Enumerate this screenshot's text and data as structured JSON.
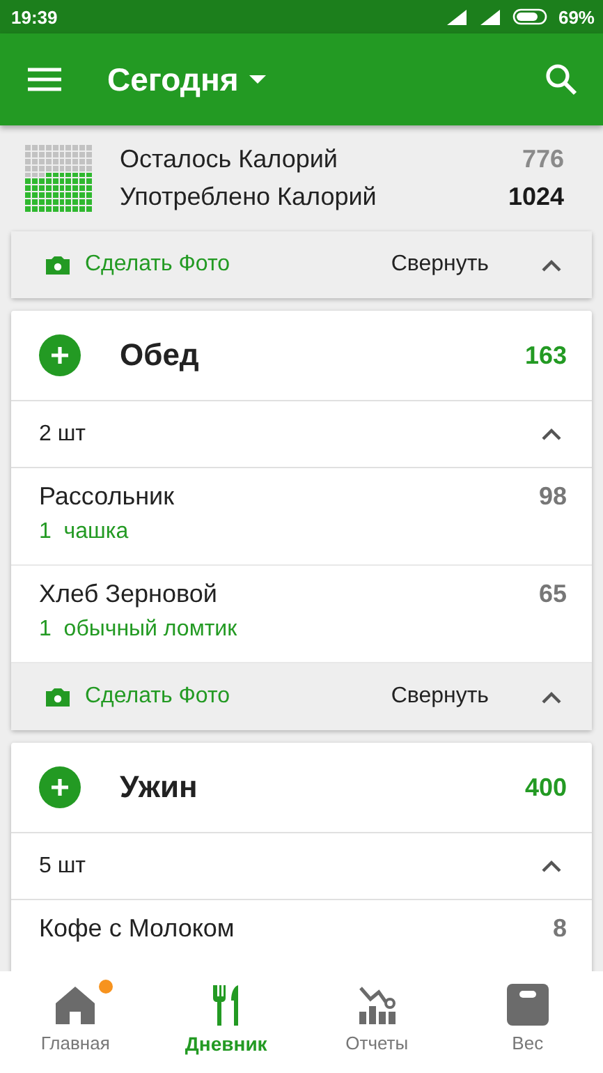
{
  "status_bar": {
    "time": "19:39",
    "battery": "69%"
  },
  "app_bar": {
    "title": "Сегодня"
  },
  "summary": {
    "remaining_label": "Осталось Калорий",
    "remaining": "776",
    "consumed_label": "Употреблено Калорий",
    "consumed": "1024"
  },
  "previous_meal_footer": {
    "photo_label": "Сделать Фото",
    "collapse_label": "Свернуть",
    "expanded": true
  },
  "meals": [
    {
      "name": "Обед",
      "calories": "163",
      "count": "2 шт",
      "expanded": true,
      "items": [
        {
          "name": "Рассольник",
          "portion": "1  чашка",
          "calories": "98"
        },
        {
          "name": "Хлеб Зерновой",
          "portion": "1  обычный ломтик",
          "calories": "65"
        }
      ],
      "footer": {
        "photo_label": "Сделать Фото",
        "collapse_label": "Свернуть",
        "expanded": true
      }
    },
    {
      "name": "Ужин",
      "calories": "400",
      "count": "5 шт",
      "expanded": true,
      "items": [
        {
          "name": "Кофе с Молоком",
          "calories": "8"
        }
      ]
    }
  ],
  "nav": [
    {
      "kind": "home",
      "label": "Главная",
      "selected": false,
      "badge": true
    },
    {
      "kind": "diary",
      "label": "Дневник",
      "selected": true,
      "badge": false
    },
    {
      "kind": "reports",
      "label": "Отчеты",
      "selected": false,
      "badge": false
    },
    {
      "kind": "weight",
      "label": "Вес",
      "selected": false,
      "badge": false
    }
  ]
}
